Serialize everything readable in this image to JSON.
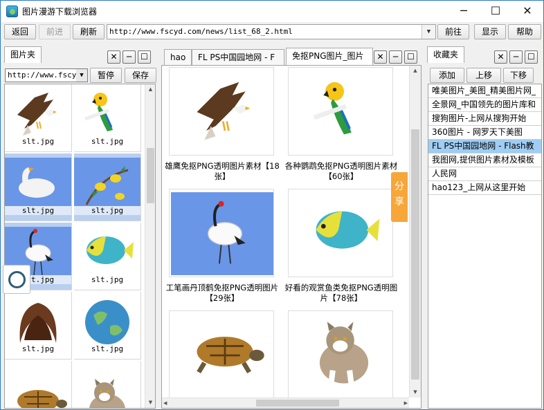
{
  "window": {
    "title": "图片漫游下载浏览器",
    "controls": {
      "minimize": "─",
      "maximize": "☐",
      "close": "✕"
    }
  },
  "toolbar": {
    "back": "返回",
    "forward": "前进",
    "refresh": "刷新",
    "address": "http://www.fscyd.com/news/list_68_2.html",
    "go": "前往",
    "show": "显示",
    "help": "帮助"
  },
  "left": {
    "tab": "图片夹",
    "url_value": "http://www.fscy",
    "pause": "暂停",
    "save": "保存",
    "files": [
      {
        "name": "slt.jpg",
        "icon": "eagle-image",
        "selected": false
      },
      {
        "name": "slt.jpg",
        "icon": "parrot-image",
        "selected": false
      },
      {
        "name": "slt.jpg",
        "icon": "swan-image",
        "selected": true
      },
      {
        "name": "slt.jpg",
        "icon": "birds-image",
        "selected": true
      },
      {
        "name": "slt.jpg",
        "icon": "crane-image",
        "selected": true
      },
      {
        "name": "slt.jpg",
        "icon": "fish-image",
        "selected": false
      },
      {
        "name": "slt.jpg",
        "icon": "hair-image",
        "selected": false
      },
      {
        "name": "slt.jpg",
        "icon": "earth-image",
        "selected": false
      }
    ]
  },
  "center": {
    "tabs": [
      "hao",
      "FL PS中国园地网 - F",
      "免抠PNG图片_图片"
    ],
    "items": [
      {
        "caption": "雄鹰免抠PNG透明图片素材【18张】",
        "icon": "eagle-image"
      },
      {
        "caption": "各种鹦鹉免抠PNG透明图片素材【60张】",
        "icon": "parrot-image"
      },
      {
        "caption": "工笔画丹顶鹤免抠PNG透明图片【29张】",
        "icon": "crane-image"
      },
      {
        "caption": "好看的观赏鱼类免抠PNG透明图片【78张】",
        "icon": "fish-image"
      },
      {
        "caption": "",
        "icon": "turtle-image"
      },
      {
        "caption": "",
        "icon": "cat-image"
      }
    ],
    "share": "分享"
  },
  "right": {
    "tab": "收藏夹",
    "add": "添加",
    "up": "上移",
    "down": "下移",
    "favorites": [
      "唯美图片_美图_精美图片网_",
      "全景网_中国领先的图片库和",
      "搜狗图片-上网从搜狗开始",
      "360图片 - 网罗天下美图",
      "FL PS中国园地网 - Flash教",
      "我图网,提供图片素材及模板",
      "人民网",
      "hao123_上网从这里开始"
    ],
    "active_index": 4
  }
}
